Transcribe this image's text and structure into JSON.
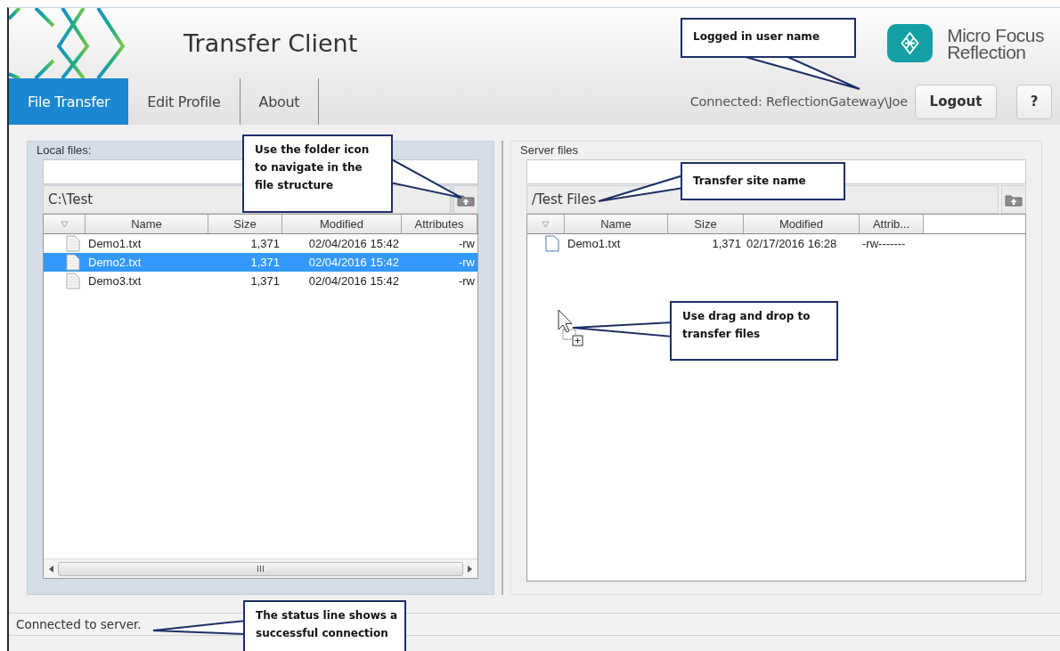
{
  "header": {
    "title": "Transfer Client",
    "brand": [
      "Micro Focus",
      "Reflection"
    ]
  },
  "tabs": [
    {
      "label": "File Transfer",
      "selected": true
    },
    {
      "label": "Edit Profile",
      "selected": false
    },
    {
      "label": "About",
      "selected": false
    }
  ],
  "connection": "Connected: ReflectionGateway\\Joe",
  "buttons": [
    {
      "label": "Logout",
      "kind": "logout"
    },
    {
      "label": "?",
      "kind": "help"
    }
  ],
  "panels": [
    {
      "title": "Local files:",
      "focused": true,
      "path": "C:\\Test",
      "scrollbar": true,
      "columns": [
        "Name",
        "Size",
        "Modified",
        "Attributes"
      ],
      "rows": [
        {
          "name": "Demo1.txt",
          "size": "1,371",
          "modified": "02/04/2016 15:42",
          "attributes": "-rw",
          "selected": false
        },
        {
          "name": "Demo2.txt",
          "size": "1,371",
          "modified": "02/04/2016 15:42",
          "attributes": "-rw",
          "selected": true
        },
        {
          "name": "Demo3.txt",
          "size": "1,371",
          "modified": "02/04/2016 15:42",
          "attributes": "-rw",
          "selected": false
        }
      ]
    },
    {
      "title": "Server files",
      "focused": false,
      "path": "/Test Files",
      "scrollbar": false,
      "columns": [
        "Name",
        "Size",
        "Modified",
        "Attrib..."
      ],
      "rows": [
        {
          "name": "Demo1.txt",
          "size": "1,371",
          "modified": "02/17/2016 16:28",
          "attributes": "-rw-------",
          "selected": false
        }
      ]
    }
  ],
  "status": "Connected to server.",
  "callouts": [
    {
      "lines": [
        "Logged in user name"
      ]
    },
    {
      "lines": [
        "Use the folder icon",
        "to navigate in the",
        "file structure"
      ]
    },
    {
      "lines": [
        "Transfer site name"
      ]
    },
    {
      "lines": [
        "Use drag and drop to",
        "transfer files"
      ]
    },
    {
      "lines": [
        "The status line shows a",
        "successful connection"
      ]
    }
  ]
}
